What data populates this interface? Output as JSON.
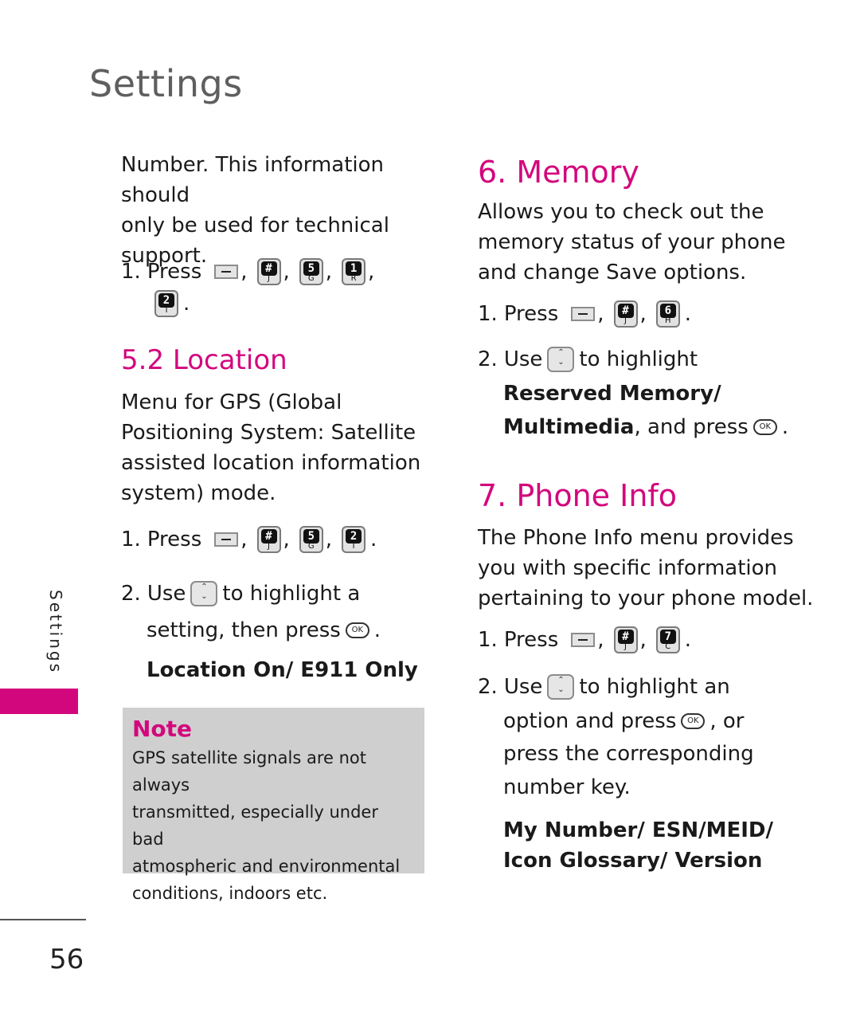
{
  "header": {
    "title": "Settings"
  },
  "sidebar": {
    "label": "Settings",
    "accent_color": "#d3077d"
  },
  "footer": {
    "page_number": "56"
  },
  "left_column": {
    "intro_lines": [
      "Number. This information should",
      "only be used for technical",
      "support."
    ],
    "intro_step": {
      "number": "1.",
      "verb": "Press",
      "keys": [
        {
          "type": "softkey",
          "icon": "menu-softkey-icon"
        },
        {
          "type": "key",
          "top": "#",
          "bottom": "J"
        },
        {
          "type": "key",
          "top": "5",
          "bottom": "G"
        },
        {
          "type": "key",
          "top": "1",
          "bottom": "R"
        },
        {
          "type": "key",
          "top": "2",
          "bottom": "T"
        }
      ]
    },
    "location": {
      "heading": "5.2 Location",
      "description_lines": [
        "Menu for GPS (Global",
        "Positioning System: Satellite",
        "assisted location information",
        "system) mode."
      ],
      "step1": {
        "number": "1.",
        "verb": "Press",
        "keys": [
          {
            "type": "softkey"
          },
          {
            "type": "key",
            "top": "#",
            "bottom": "J"
          },
          {
            "type": "key",
            "top": "5",
            "bottom": "G"
          },
          {
            "type": "key",
            "top": "2",
            "bottom": "T"
          }
        ]
      },
      "step2": {
        "number": "2.",
        "verb": "Use",
        "text_a": "to highlight a",
        "text_b": "setting, then press",
        "ok_label": "OK",
        "options": "Location On/ E911 Only"
      }
    },
    "note": {
      "title": "Note",
      "lines": [
        "GPS satellite signals are not always",
        "transmitted, especially under bad",
        "atmospheric and environmental",
        "conditions, indoors etc."
      ]
    }
  },
  "right_column": {
    "memory": {
      "heading": "6. Memory",
      "description_lines": [
        "Allows you to check out the",
        "memory status of your phone",
        "and change Save options."
      ],
      "step1": {
        "number": "1.",
        "verb": "Press",
        "keys": [
          {
            "type": "softkey"
          },
          {
            "type": "key",
            "top": "#",
            "bottom": "J"
          },
          {
            "type": "key",
            "top": "6",
            "bottom": "H"
          }
        ]
      },
      "step2": {
        "number": "2.",
        "verb": "Use",
        "text_a": "to highlight",
        "bold_a": "Reserved Memory/",
        "bold_b": "Multimedia",
        "text_b": ", and press",
        "ok_label": "OK"
      }
    },
    "phone_info": {
      "heading": "7. Phone Info",
      "description_lines": [
        "The Phone Info menu provides",
        "you with specific information",
        "pertaining to your phone model."
      ],
      "step1": {
        "number": "1.",
        "verb": "Press",
        "keys": [
          {
            "type": "softkey"
          },
          {
            "type": "key",
            "top": "#",
            "bottom": "J"
          },
          {
            "type": "key",
            "top": "7",
            "bottom": "C"
          }
        ]
      },
      "step2": {
        "number": "2.",
        "verb": "Use",
        "text_a": "to highlight an",
        "text_b": "option and press",
        "text_c": ", or",
        "text_d": "press the corresponding",
        "text_e": "number key.",
        "ok_label": "OK",
        "options_line1": "My Number/ ESN/MEID/",
        "options_line2": "Icon Glossary/ Version"
      }
    }
  },
  "icons": {
    "nav_up": "⌃",
    "nav_down": "⌄",
    "comma": ",",
    "period": "."
  }
}
